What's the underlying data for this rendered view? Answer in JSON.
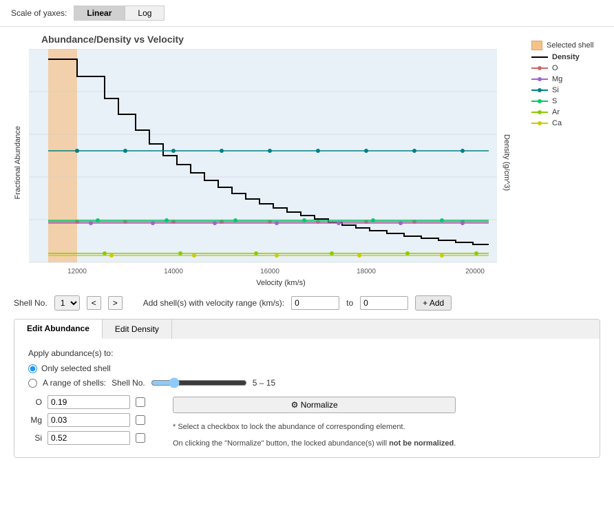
{
  "topBar": {
    "scaleLabel": "Scale of yaxes:",
    "linearBtn": "Linear",
    "logBtn": "Log"
  },
  "chart": {
    "title": "Abundance/Density vs Velocity",
    "xAxisLabel": "Velocity (km/s)",
    "yAxisLeftLabel": "Fractional Abundance",
    "yAxisRightLabel": "Density (g/cm^3)",
    "xMin": 11000,
    "xMax": 20000,
    "yLeftMin": 0,
    "yLeftMax": 1,
    "yRightMin": 0,
    "yRightMax": 14
  },
  "legend": {
    "items": [
      {
        "type": "box",
        "color": "#f5c28a",
        "label": "Selected shell"
      },
      {
        "type": "line",
        "color": "#000000",
        "label": "Density",
        "bold": true
      },
      {
        "type": "dotline",
        "color": "#ff9999",
        "label": "O"
      },
      {
        "type": "dotline",
        "color": "#9966cc",
        "label": "Mg"
      },
      {
        "type": "dotline",
        "color": "#008080",
        "label": "Si"
      },
      {
        "type": "dotline",
        "color": "#00cc66",
        "label": "S"
      },
      {
        "type": "dotline",
        "color": "#66cc00",
        "label": "Ar"
      },
      {
        "type": "dotline",
        "color": "#cccc00",
        "label": "Ca"
      }
    ]
  },
  "controls": {
    "shellLabel": "Shell No.",
    "shellValue": "1",
    "prevBtn": "<",
    "nextBtn": ">",
    "addShellLabel": "Add shell(s) with velocity range (km/s):",
    "fromValue": "0",
    "toLabel": "to",
    "toValue": "0",
    "addBtn": "+ Add"
  },
  "tabs": {
    "editAbundance": "Edit Abundance",
    "editDensity": "Edit Density"
  },
  "editAbundance": {
    "applyLabel": "Apply abundance(s) to:",
    "onlyShellLabel": "Only selected shell",
    "rangeLabel": "A range of shells:",
    "shellNoLabel": "Shell No.",
    "rangeValue": "5 – 15",
    "elements": [
      {
        "symbol": "O",
        "value": "0.19"
      },
      {
        "symbol": "Mg",
        "value": "0.03"
      },
      {
        "symbol": "Si",
        "value": "0.52"
      }
    ],
    "normalizeBtn": "⚙ Normalize",
    "selectNote": "* Select a checkbox to lock the abundance of corresponding element.",
    "normalizeNote1": "On clicking the \"Normalize\" button, the locked abundance(s) will ",
    "normalizeNote2": "not be normalized",
    "normalizeNote3": "."
  }
}
